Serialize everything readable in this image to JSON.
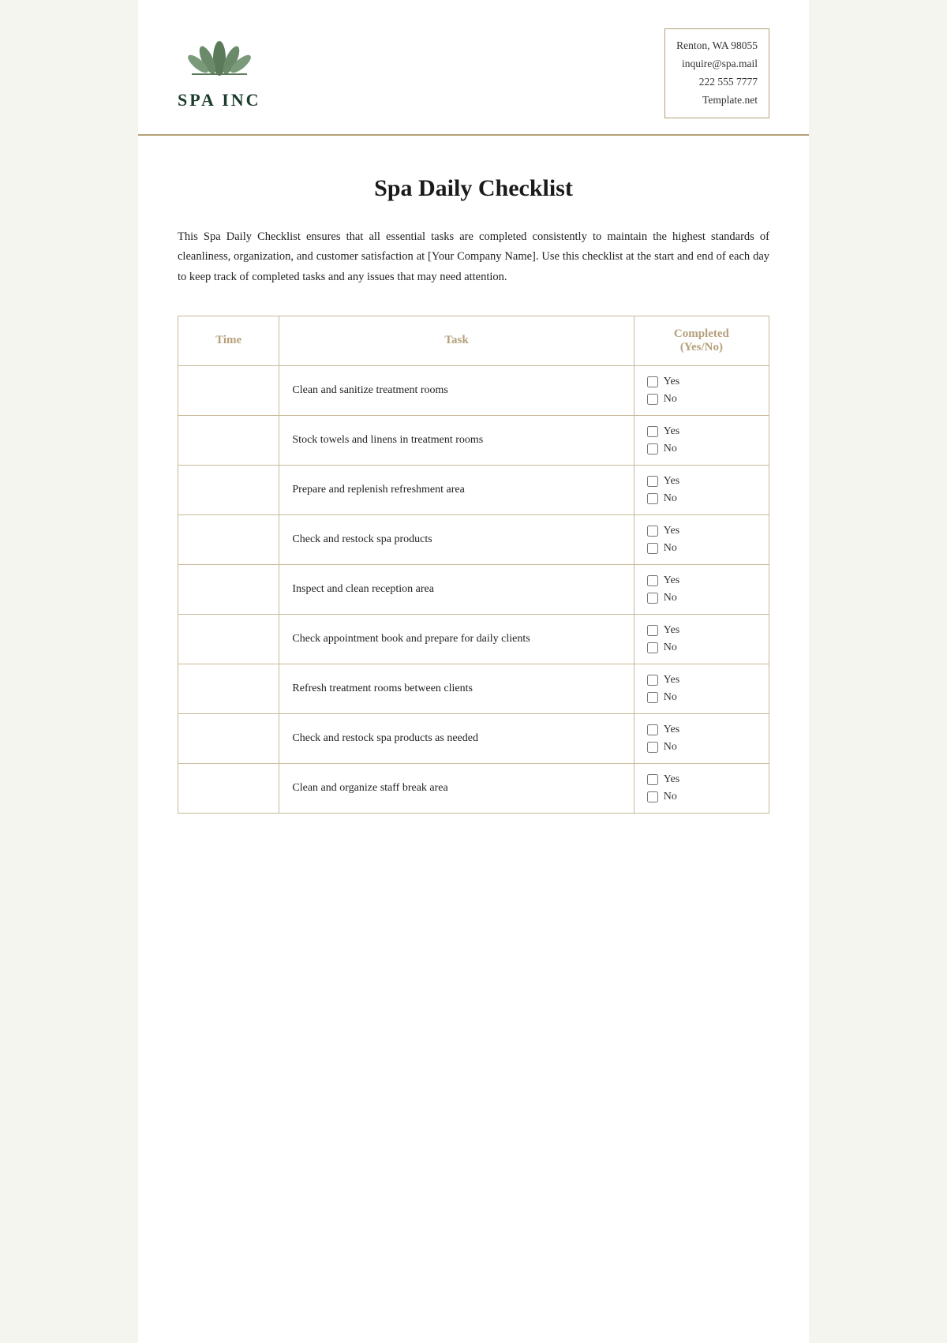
{
  "header": {
    "company_name": "SPA INC",
    "contact": {
      "address": "Renton, WA 98055",
      "email": "inquire@spa.mail",
      "phone": "222 555 7777",
      "website": "Template.net"
    }
  },
  "document": {
    "title": "Spa Daily Checklist",
    "description": "This Spa Daily Checklist ensures that all essential tasks are completed consistently to maintain the highest standards of cleanliness, organization, and customer satisfaction at [Your Company Name]. Use this checklist at the start and end of each day to keep track of completed tasks and any issues that may need attention."
  },
  "table": {
    "headers": {
      "time": "Time",
      "task": "Task",
      "completed": "Completed",
      "completed_sub": "(Yes/No)"
    },
    "rows": [
      {
        "time": "",
        "task": "Clean and sanitize treatment rooms"
      },
      {
        "time": "",
        "task": "Stock towels and linens in treatment rooms"
      },
      {
        "time": "",
        "task": "Prepare and replenish refreshment area"
      },
      {
        "time": "",
        "task": "Check and restock spa products"
      },
      {
        "time": "",
        "task": "Inspect and clean reception area"
      },
      {
        "time": "",
        "task": "Check appointment book and prepare for daily clients"
      },
      {
        "time": "",
        "task": "Refresh treatment rooms between clients"
      },
      {
        "time": "",
        "task": "Check and restock spa products as needed"
      },
      {
        "time": "",
        "task": "Clean and organize staff break area"
      }
    ],
    "yes_label": "Yes",
    "no_label": "No"
  }
}
